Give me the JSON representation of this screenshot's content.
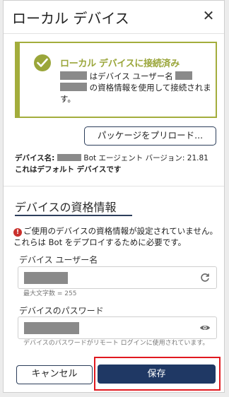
{
  "dialog": {
    "title": "ローカル デバイス",
    "close_glyph": "✕"
  },
  "status": {
    "title": "ローカル デバイスに接続済み",
    "text_part1": " はデバイス ユーザー名 ",
    "text_part2": " の資格情報を使用して接続されます。",
    "accent_color": "#9aa63a"
  },
  "preload_button": {
    "label": "パッケージをプリロード..."
  },
  "device_info": {
    "name_label": "デバイス名: ",
    "agent_text": " Bot エージェント バージョン: 21.81",
    "default_text": "これはデフォルト デバイスです"
  },
  "credentials": {
    "section_title": "デバイスの資格情報",
    "warning_icon": "!",
    "warning_text": "ご使用のデバイスの資格情報が設定されていません。これらは Bot をデプロイするために必要です。",
    "username_label": "デバイス ユーザー名",
    "username_hint": "最大文字数 = 255",
    "password_label": "デバイスのパスワード",
    "password_hint": "デバイスのパスワードがリモート ログインに使用されています。"
  },
  "footer": {
    "cancel_label": "キャンセル",
    "save_label": "保存",
    "save_color": "#1f3864",
    "highlight_color": "#e0191f"
  }
}
